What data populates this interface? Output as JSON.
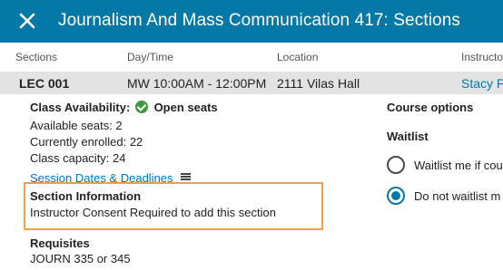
{
  "header": {
    "title": "Journalism And Mass Communication 417: Sections",
    "close_icon": "close-icon"
  },
  "columns": [
    "Sections",
    "Day/Time",
    "Location",
    "Instructor"
  ],
  "section_row": {
    "section": "LEC 001",
    "day_time": "MW 10:00AM - 12:00PM",
    "location": "2111 Vilas Hall",
    "instructor": "Stacy Fo"
  },
  "availability": {
    "label": "Class Availability:",
    "status": "Open seats",
    "status_color": "#3e9b3c",
    "available_seats": "Available seats: 2",
    "enrolled": "Currently enrolled: 22",
    "capacity": "Class capacity: 24"
  },
  "session_link": "Session Dates & Deadlines",
  "section_info": {
    "heading": "Section Information",
    "text": "Instructor Consent Required to add this section",
    "highlight_color": "#f0a04b"
  },
  "requisites": {
    "heading": "Requisites",
    "text": "JOURN 335 or 345"
  },
  "course_options": {
    "heading": "Course options",
    "waitlist_heading": "Waitlist",
    "options": [
      {
        "label": "Waitlist me if cou",
        "selected": false
      },
      {
        "label": "Do not waitlist m",
        "selected": true
      }
    ]
  },
  "colors": {
    "brand": "#0479a8",
    "row_bg": "#e3e3e3"
  }
}
